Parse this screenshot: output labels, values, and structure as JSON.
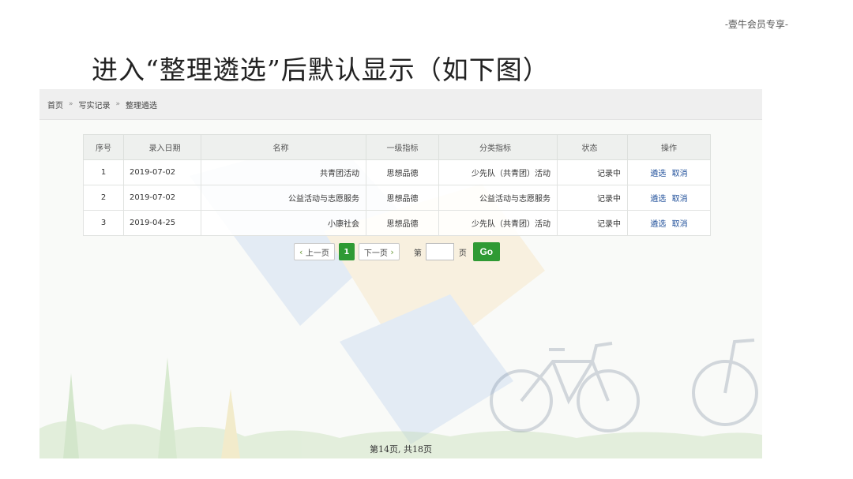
{
  "doc_tag": "-壹牛会员专享-",
  "slide_title": "进入“整理遴选”后默认显示（如下图）",
  "breadcrumb": {
    "items": [
      "首页",
      "写实记录",
      "整理遴选"
    ],
    "separator": "»"
  },
  "table": {
    "headers": [
      "序号",
      "录入日期",
      "名称",
      "一级指标",
      "分类指标",
      "状态",
      "操作"
    ],
    "rows": [
      {
        "idx": "1",
        "date": "2019-07-02",
        "name": "共青团活动",
        "level1": "思想品德",
        "category": "少先队（共青团）活动",
        "status": "记录中",
        "op_select": "遴选",
        "op_cancel": "取消"
      },
      {
        "idx": "2",
        "date": "2019-07-02",
        "name": "公益活动与志愿服务",
        "level1": "思想品德",
        "category": "公益活动与志愿服务",
        "status": "记录中",
        "op_select": "遴选",
        "op_cancel": "取消"
      },
      {
        "idx": "3",
        "date": "2019-04-25",
        "name": "小康社会",
        "level1": "思想品德",
        "category": "少先队（共青团）活动",
        "status": "记录中",
        "op_select": "遴选",
        "op_cancel": "取消"
      }
    ]
  },
  "pager": {
    "prev_label": "上一页",
    "current_page": "1",
    "next_label": "下一页",
    "page_prefix": "第",
    "page_input_value": "",
    "page_suffix": "页",
    "go_label": "Go"
  },
  "footer": "第14页, 共18页",
  "colors": {
    "accent_green": "#2f9a34",
    "link_blue": "#1f4f9a"
  },
  "icons": [
    "chevron-left-icon",
    "chevron-right-icon"
  ]
}
